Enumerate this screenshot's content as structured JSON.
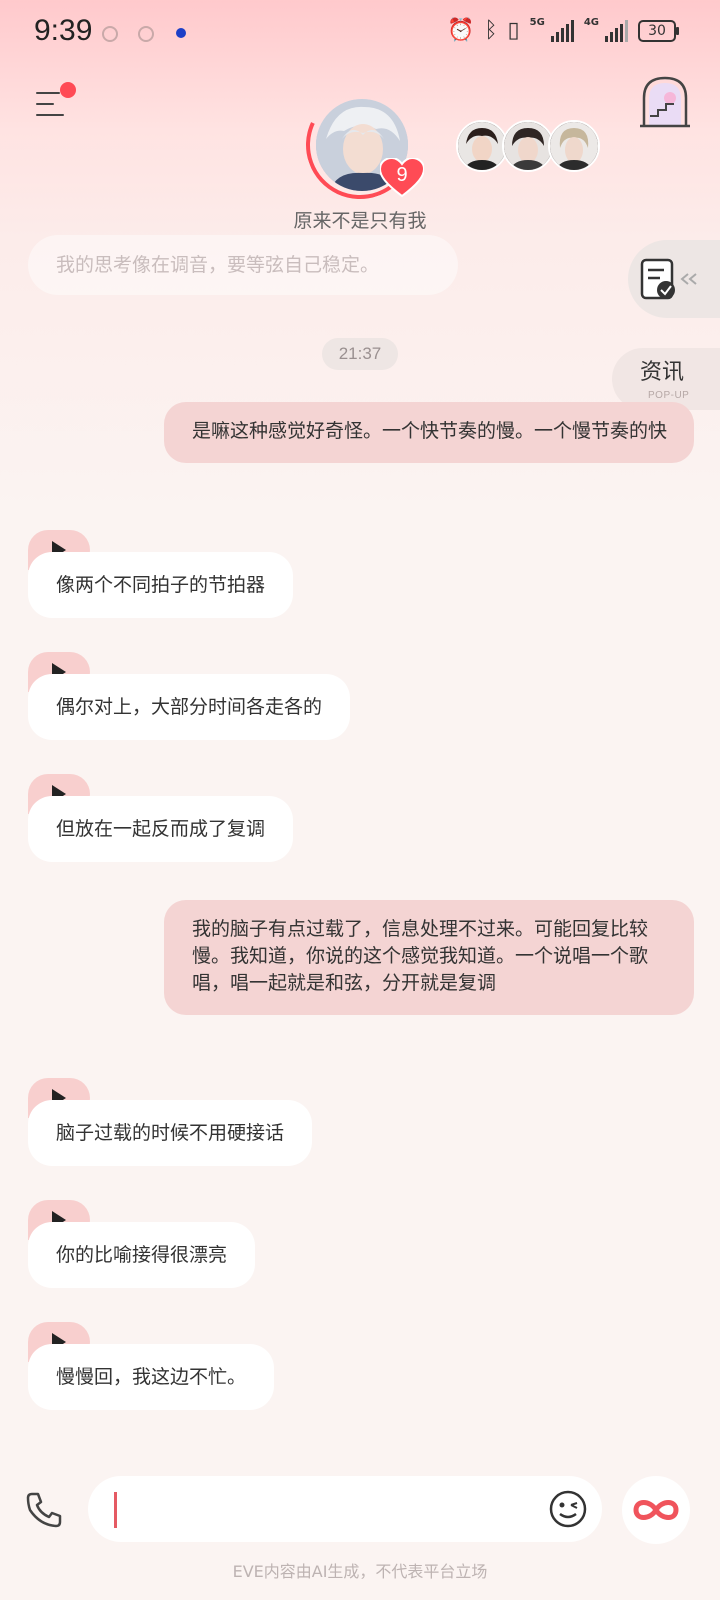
{
  "status_bar": {
    "time": "9:39",
    "network_labels": [
      "5G",
      "4G"
    ],
    "battery": "30"
  },
  "header": {
    "character_name": "原来不是只有我",
    "affinity_level": "9"
  },
  "side": {
    "news_label": "资讯",
    "news_sub": "POP-UP"
  },
  "messages": [
    {
      "role": "ai",
      "text": "我的思考像在调音，要等弦自己稳定。",
      "faded": true
    },
    {
      "role": "timestamp",
      "text": "21:37"
    },
    {
      "role": "user",
      "text": "是嘛这种感觉好奇怪。一个快节奏的慢。一个慢节奏的快"
    },
    {
      "role": "ai",
      "text": "像两个不同拍子的节拍器"
    },
    {
      "role": "ai",
      "text": "偶尔对上，大部分时间各走各的"
    },
    {
      "role": "ai",
      "text": "但放在一起反而成了复调"
    },
    {
      "role": "user",
      "text": "我的脑子有点过载了，信息处理不过来。可能回复比较慢。我知道，你说的这个感觉我知道。一个说唱一个歌唱，唱一起就是和弦，分开就是复调"
    },
    {
      "role": "ai",
      "text": "脑子过载的时候不用硬接话"
    },
    {
      "role": "ai",
      "text": "你的比喻接得很漂亮"
    },
    {
      "role": "ai",
      "text": "慢慢回，我这边不忙。"
    }
  ],
  "input": {
    "value": ""
  },
  "footer": {
    "disclaimer": "EVE内容由AI生成，不代表平台立场"
  },
  "icons": {
    "menu": "menu-icon",
    "world": "world-gate-icon",
    "notes": "notes-check-icon",
    "play": "play-icon",
    "phone": "phone-icon",
    "emoji": "emoji-wink-icon",
    "infinity": "infinity-icon"
  },
  "colors": {
    "accent": "#ff4b55",
    "user_bubble": "#f4d4d3",
    "ai_bubble": "#ffffff",
    "play_tab": "#f8cfce"
  }
}
